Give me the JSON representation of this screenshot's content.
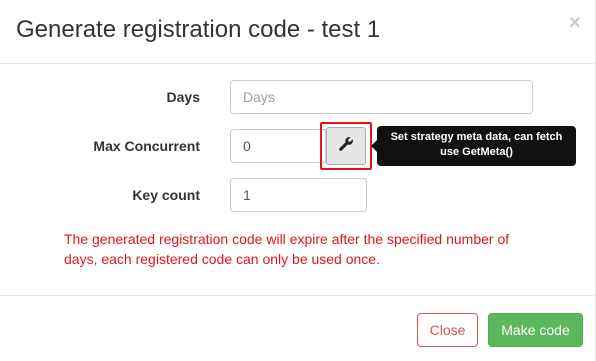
{
  "dialog": {
    "title": "Generate registration code - test 1",
    "close_glyph": "×",
    "close_icon": "close-icon"
  },
  "form": {
    "days": {
      "label": "Days",
      "value": "",
      "placeholder": "Days"
    },
    "max_concurrent": {
      "label": "Max Concurrent",
      "value": "0",
      "placeholder": ""
    },
    "key_count": {
      "label": "Key count",
      "value": "1",
      "placeholder": ""
    },
    "meta_button": {
      "icon": "wrench-icon"
    }
  },
  "tooltip": {
    "text": "Set strategy meta data, can fetch use GetMeta()"
  },
  "note": "The generated registration code will expire after the specified number of days, each registered code can only be used once.",
  "footer": {
    "close_label": "Close",
    "make_label": "Make code"
  },
  "colors": {
    "danger": "#d9534f",
    "success": "#5cb85c",
    "note_text": "#e0161b",
    "tooltip_bg": "#111111",
    "highlight": "#e0161b"
  }
}
